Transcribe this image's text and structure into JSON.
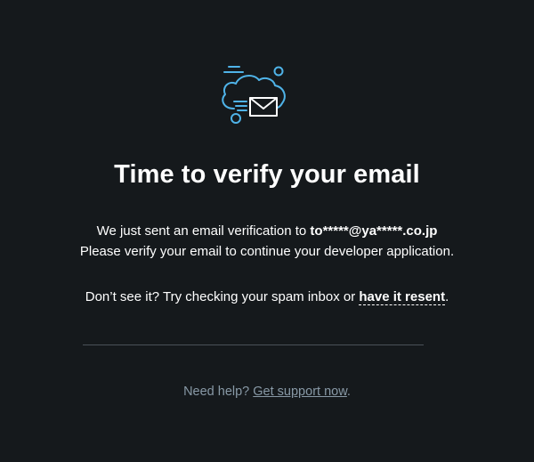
{
  "illustration": {
    "icon": "cloud-envelope-icon",
    "accent_color": "#4fb3e8"
  },
  "title": "Time to verify your email",
  "message": {
    "line1_prefix": "We just sent an email verification to ",
    "email": "to*****@ya*****.co.jp",
    "line2": "Please verify your email to continue your developer application.",
    "line3_prefix": "Don’t see it? Try checking your spam inbox or ",
    "resend_link": "have it resent",
    "line3_suffix": "."
  },
  "help": {
    "prefix": "Need help? ",
    "link": "Get support now",
    "suffix": "."
  },
  "colors": {
    "background": "#15191c",
    "text": "#ffffff",
    "muted": "#8899a6",
    "divider": "#4a5158"
  }
}
